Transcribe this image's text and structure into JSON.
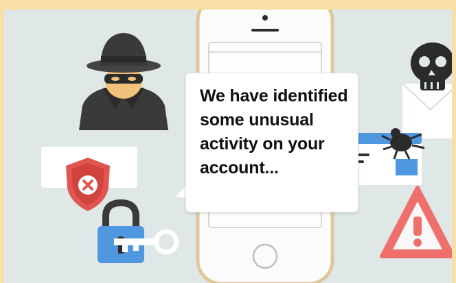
{
  "message": {
    "text": "We have identified some unusual activity on your account..."
  },
  "icons": {
    "hacker": "hacker-icon",
    "phone": "phone-icon",
    "skull_email": "skull-email-icon",
    "shield": "shield-error-icon",
    "padlock": "padlock-icon",
    "key": "key-icon",
    "bug_window": "bug-window-icon",
    "warning": "warning-icon"
  },
  "colors": {
    "frame": "#f7dfa6",
    "background": "#dfe7e7",
    "hacker_dark": "#3a3a3a",
    "skin": "#f2c27b",
    "shield_red": "#e0554f",
    "lock_blue": "#4f97de",
    "warning_red": "#ee6f6c"
  }
}
